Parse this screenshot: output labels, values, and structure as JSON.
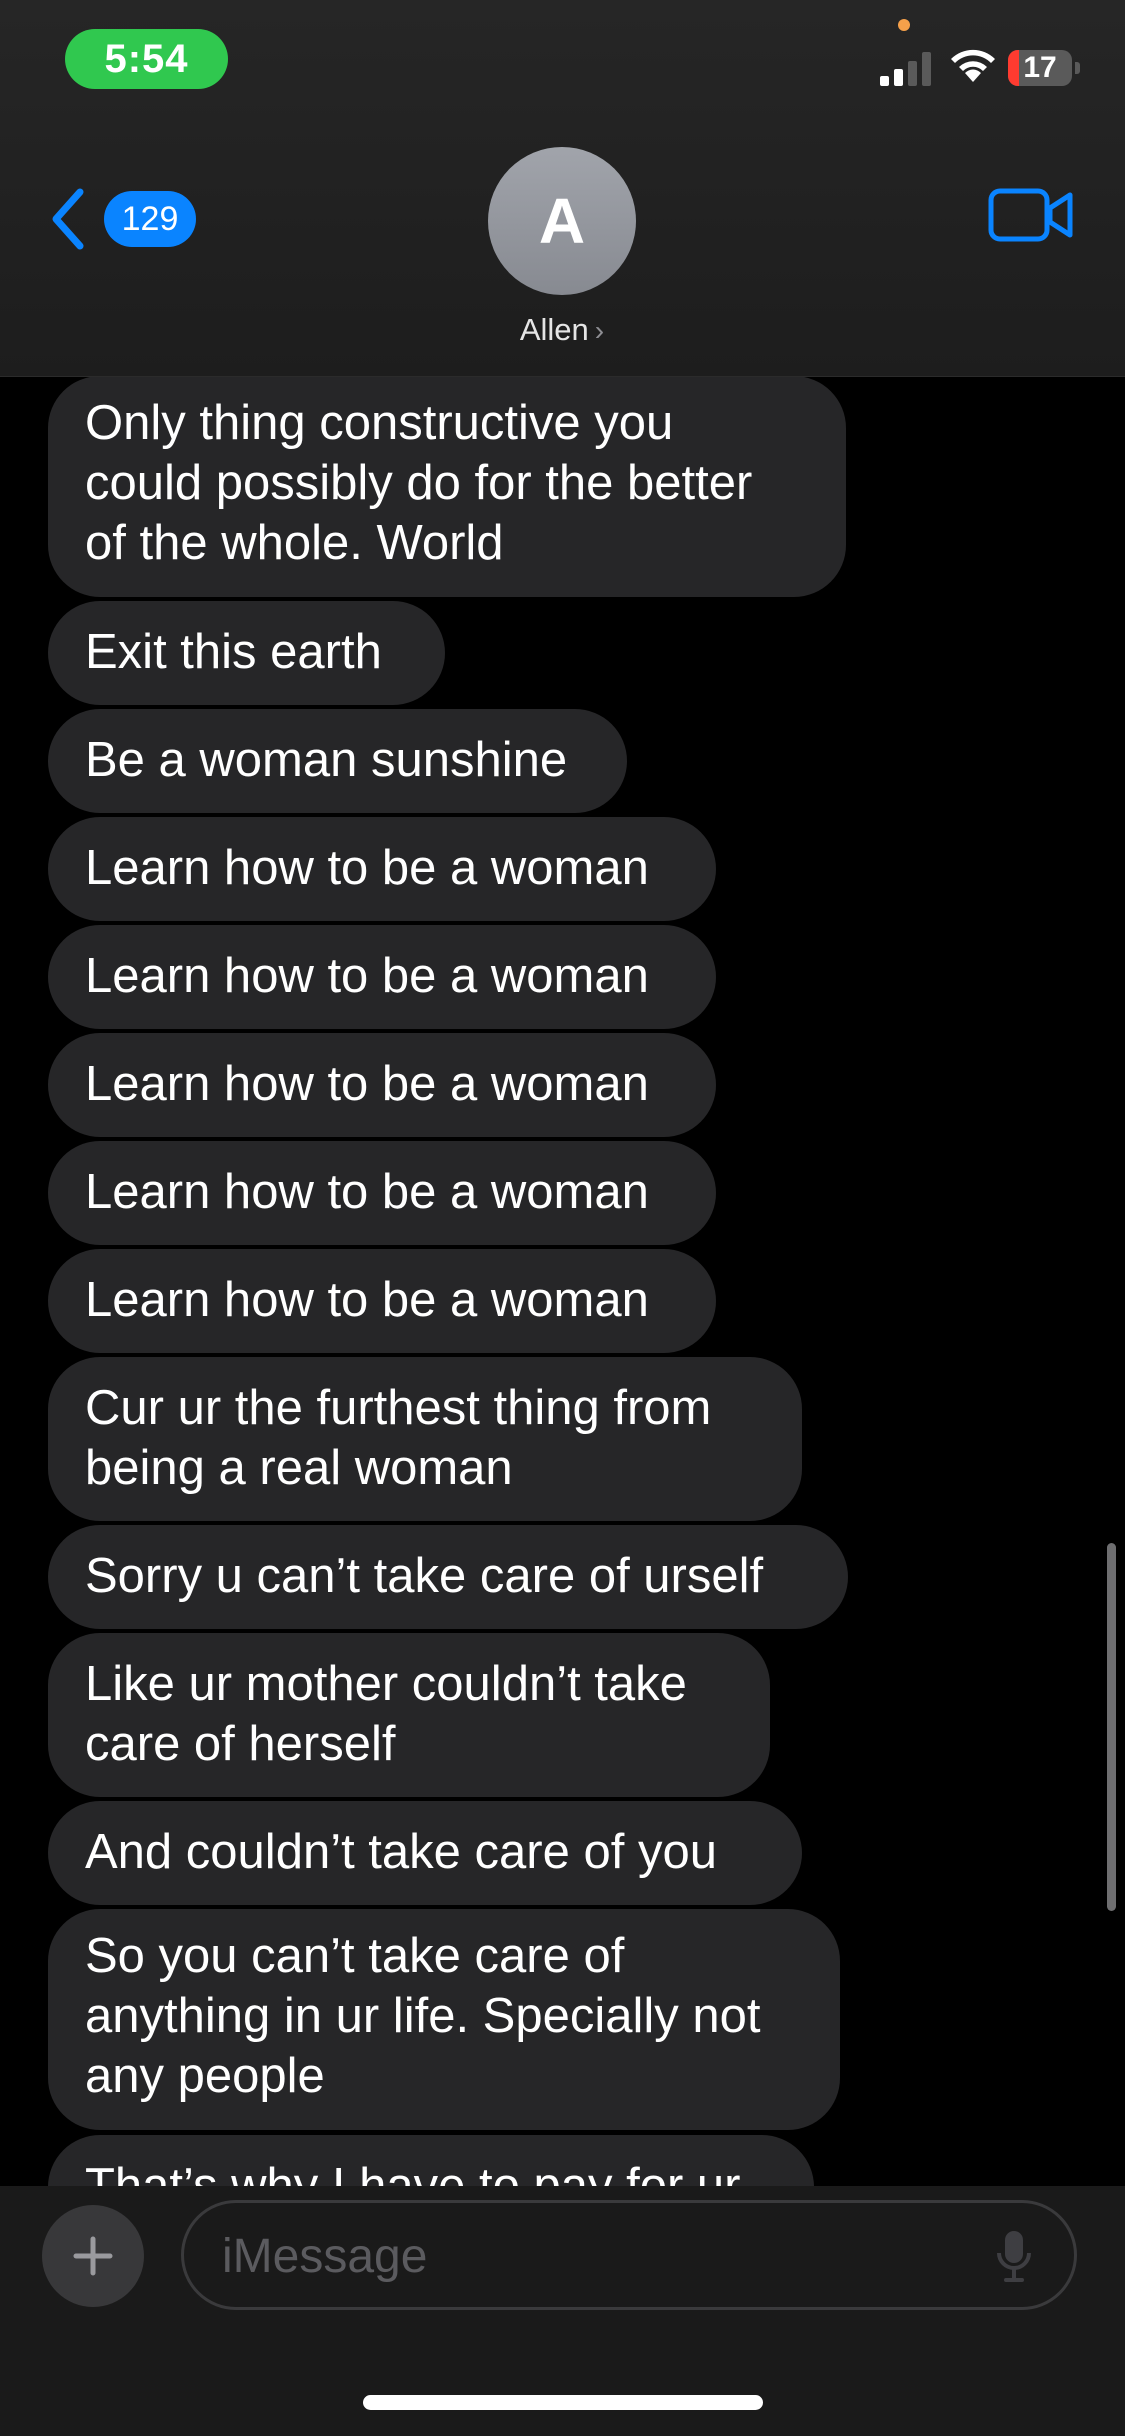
{
  "status_bar": {
    "time": "5:54",
    "battery": "17",
    "battery_level": 0.17,
    "signal_bars": 2
  },
  "header": {
    "back_count": "129",
    "avatar_initial": "A",
    "contact_name": "Allen",
    "icons": [
      "chevron-left-icon",
      "video-camera-icon"
    ]
  },
  "messages": [
    {
      "text": "Only thing constructive you\ncould possibly do for the better\nof the whole. World"
    },
    {
      "text": "Exit this earth"
    },
    {
      "text": "Be a woman sunshine"
    },
    {
      "text": "Learn how to be a woman"
    },
    {
      "text": "Learn how to be a woman"
    },
    {
      "text": "Learn how to be a woman"
    },
    {
      "text": "Learn how to be a woman"
    },
    {
      "text": "Learn how to be a woman"
    },
    {
      "text": "Cur ur the furthest thing from\nbeing a real woman"
    },
    {
      "text": "Sorry u can’t take care of urself"
    },
    {
      "text": "Like ur mother couldn’t take\ncare of herself"
    },
    {
      "text": "And couldn’t take care of you"
    },
    {
      "text": "So you can’t take care of\nanything in ur life. Specially not\nany people"
    },
    {
      "text": "That’s why I have to pay for ur"
    }
  ],
  "input": {
    "placeholder": "iMessage"
  },
  "colors": {
    "incoming_bubble": "#262628",
    "accent": "#0a84ff",
    "time_pill": "#30c84f"
  }
}
